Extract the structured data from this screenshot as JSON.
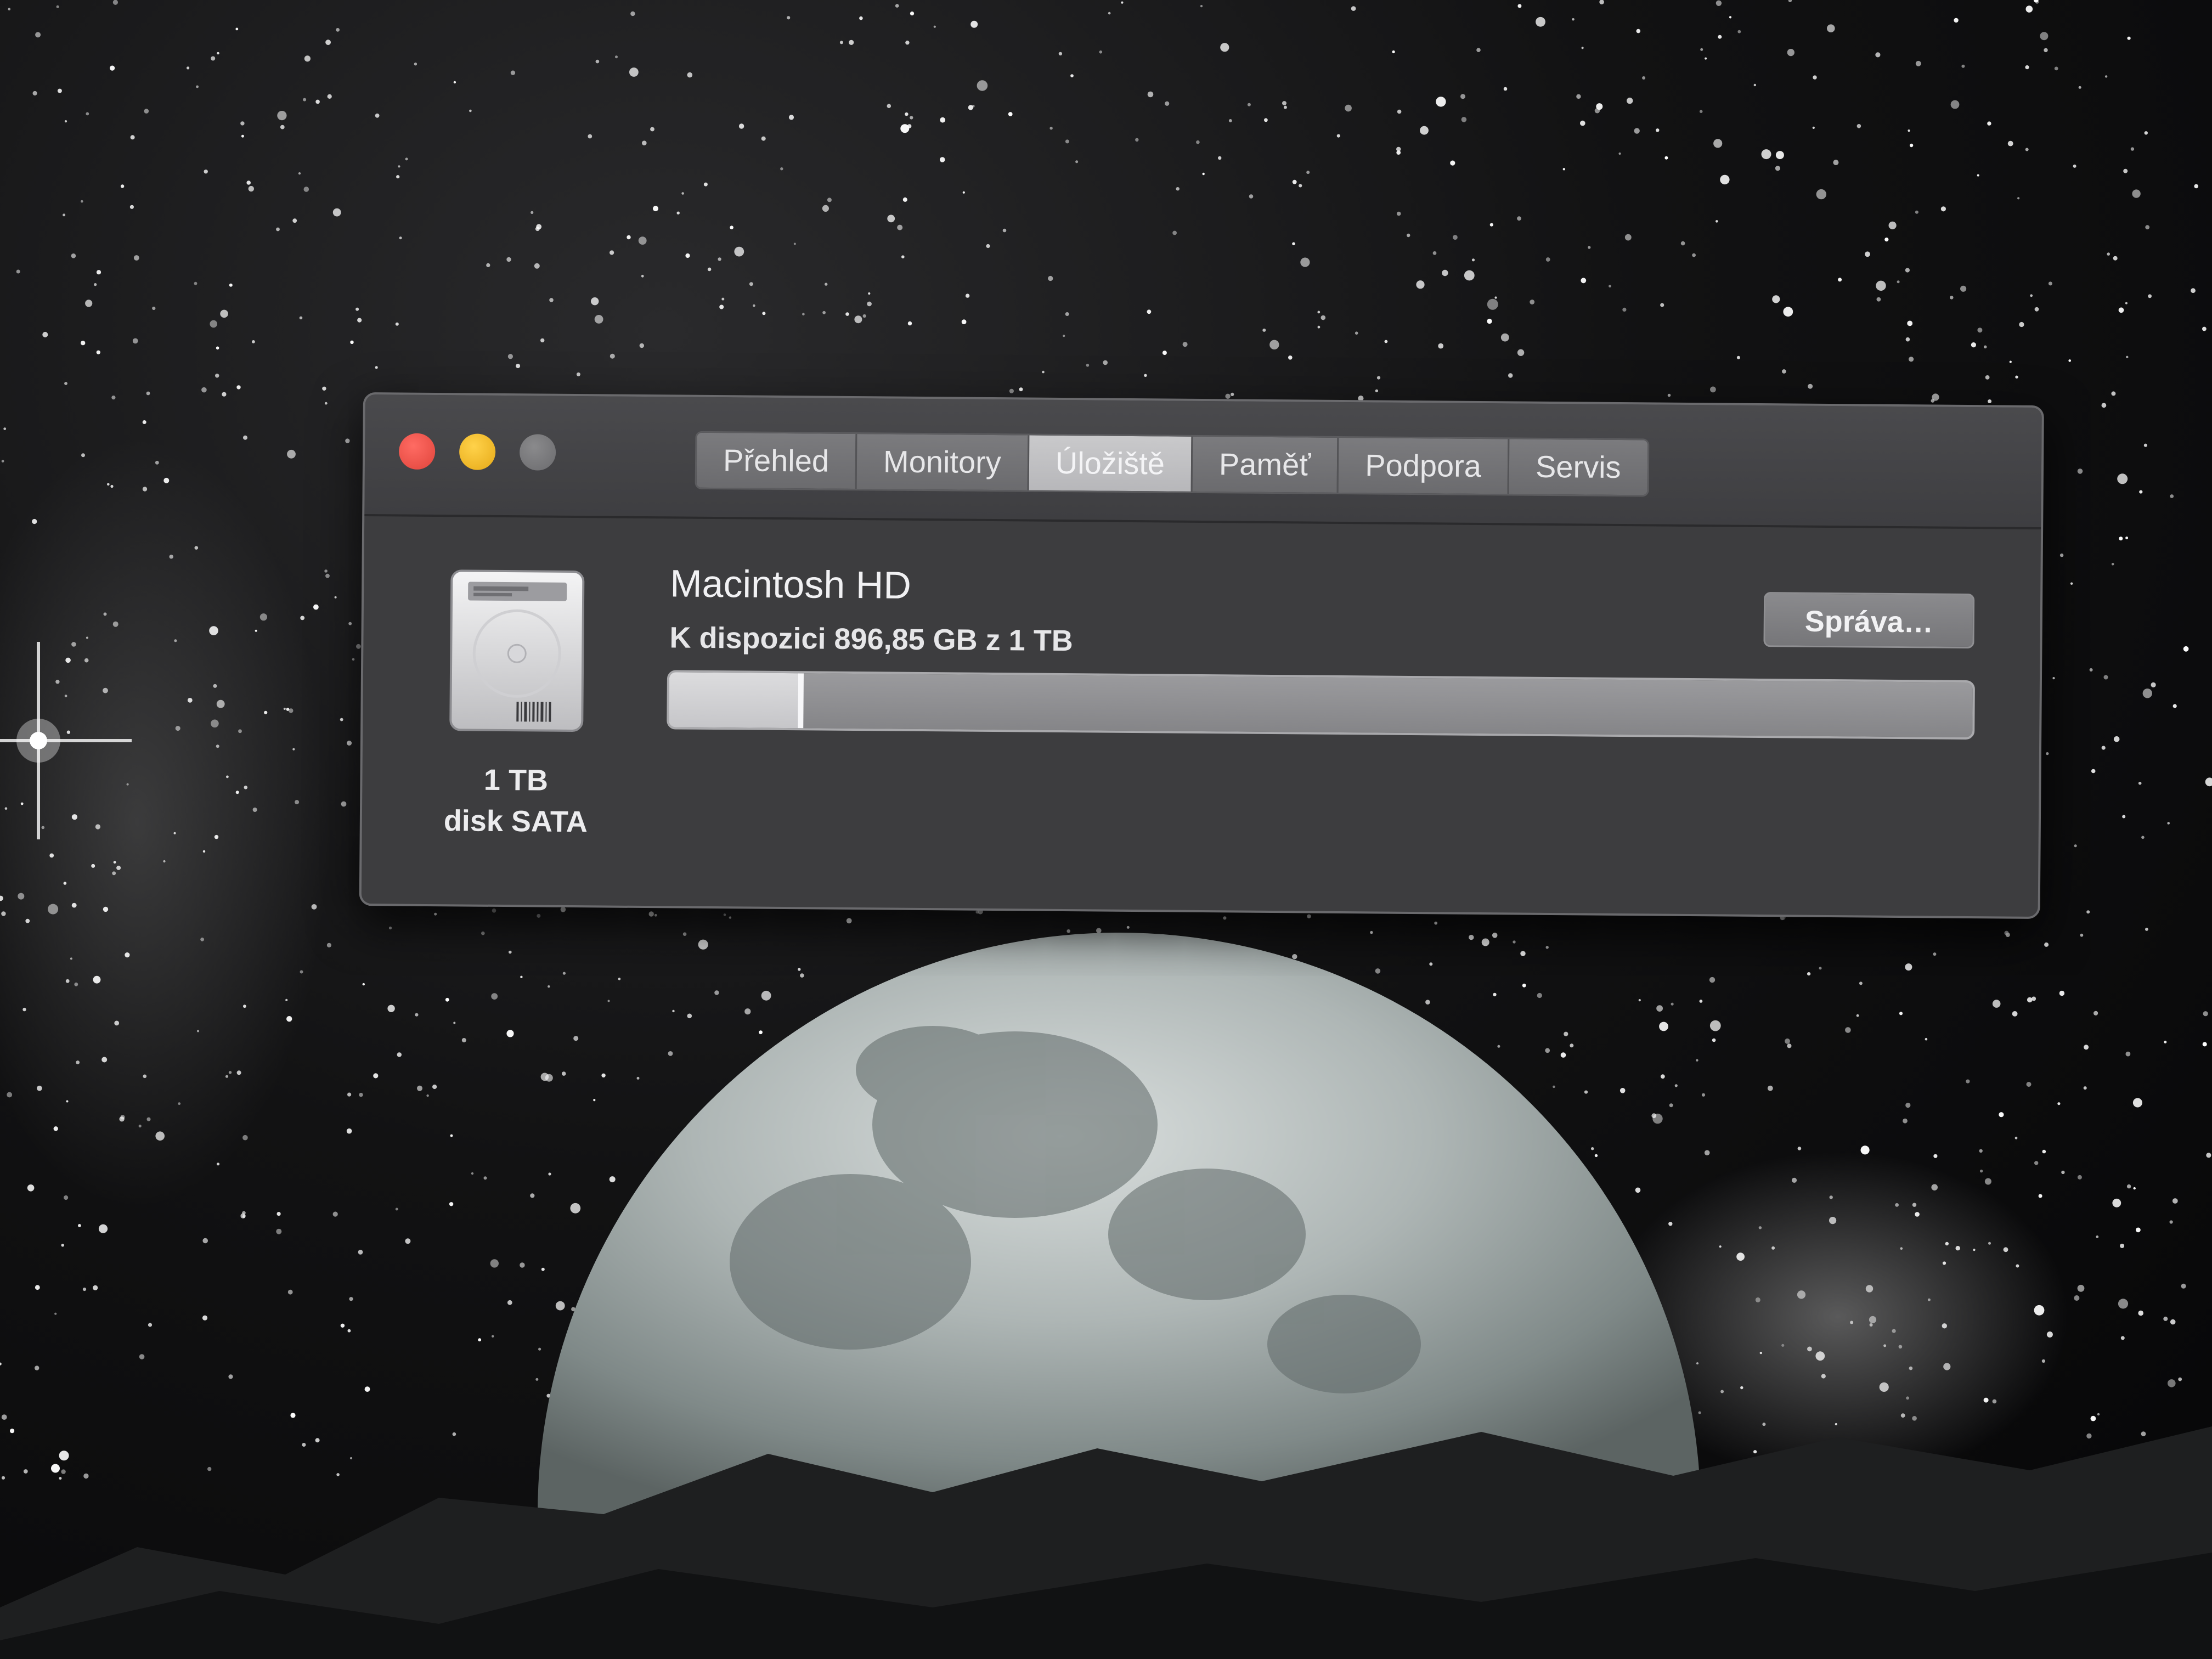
{
  "window": {
    "tabs": [
      {
        "label": "Přehled",
        "active": false
      },
      {
        "label": "Monitory",
        "active": false
      },
      {
        "label": "Úložiště",
        "active": true
      },
      {
        "label": "Paměť",
        "active": false
      },
      {
        "label": "Podpora",
        "active": false
      },
      {
        "label": "Servis",
        "active": false
      }
    ]
  },
  "storage": {
    "disk": {
      "size": "1 TB",
      "type": "disk SATA",
      "icon": "hard-drive-icon"
    },
    "volume": {
      "name": "Macintosh HD",
      "available_text": "K dispozici 896,85 GB z 1 TB",
      "used_fraction": 0.103
    },
    "manage_button_label": "Správa…"
  },
  "colors": {
    "close": "#ff5f57",
    "minimize": "#febc2e",
    "zoom_inactive": "#7a7a7d",
    "window_bg": "#3d3d3f"
  }
}
